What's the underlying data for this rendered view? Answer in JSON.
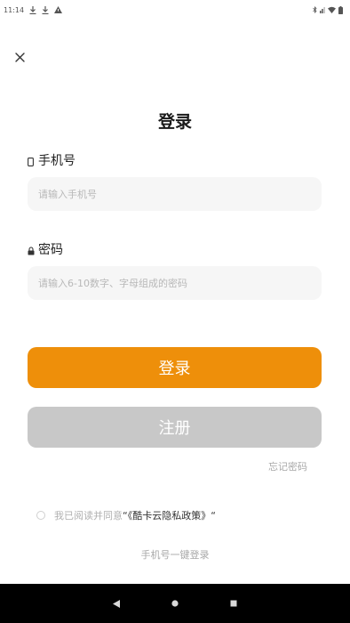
{
  "status_bar": {
    "time": "11:14",
    "left_icons": [
      "download-icon",
      "download-icon",
      "warning-icon"
    ],
    "right_icons": [
      "bluetooth-icon",
      "signal-icon",
      "wifi-icon",
      "battery-icon"
    ]
  },
  "header": {
    "close_icon": "close-icon"
  },
  "title": "登录",
  "phone": {
    "label": "手机号",
    "icon": "phone-icon",
    "placeholder": "请输入手机号",
    "value": ""
  },
  "password": {
    "label": "密码",
    "icon": "lock-icon",
    "placeholder": "请输入6-10数字、字母组成的密码",
    "value": ""
  },
  "buttons": {
    "login": "登录",
    "register": "注册"
  },
  "forgot_password": "忘记密码",
  "agreement": {
    "prefix": "我已阅读并同意",
    "policy": "“《酷卡云隐私政策》“",
    "checked": false
  },
  "one_click_login": "手机号一键登录",
  "colors": {
    "accent": "#ee8f0a",
    "disabled_button": "#c8c8c8",
    "input_background": "#f6f6f6"
  },
  "nav_bar": {
    "back": "back-icon",
    "home": "home-icon",
    "recents": "recents-icon"
  }
}
